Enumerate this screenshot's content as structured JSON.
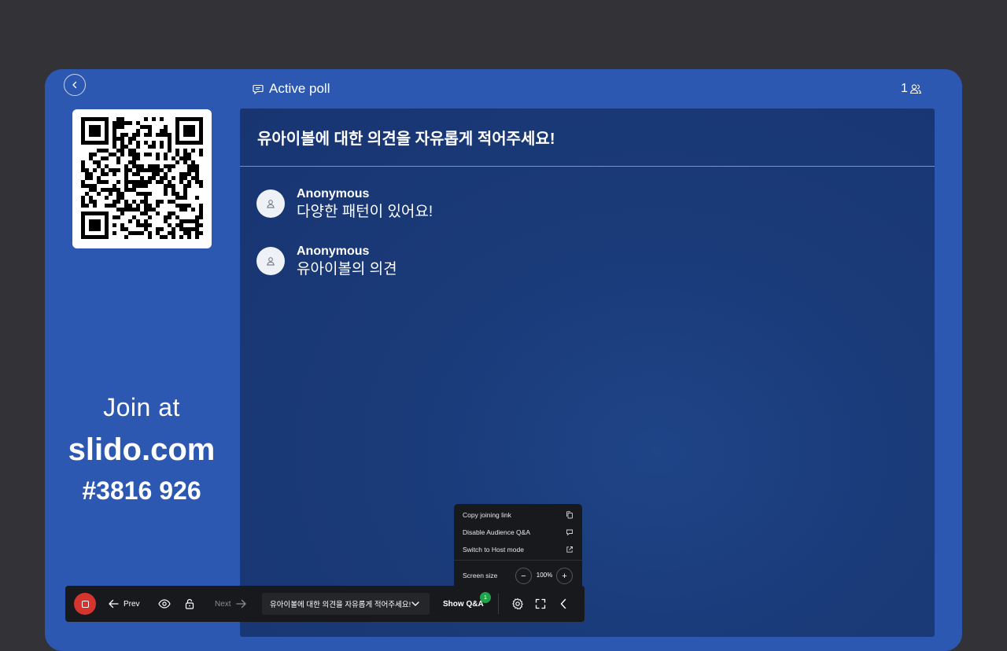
{
  "header": {
    "poll_status": "Active poll",
    "participant_count": "1"
  },
  "join": {
    "line1": "Join at",
    "site": "slido.com",
    "code": "#3816 926"
  },
  "poll": {
    "question": "유아이볼에 대한 의견을 자유롭게 적어주세요!",
    "responses": [
      {
        "author": "Anonymous",
        "text": "다양한 패턴이 있어요!"
      },
      {
        "author": "Anonymous",
        "text": "유아이볼의 의견"
      }
    ]
  },
  "toolbar": {
    "prev_label": "Prev",
    "next_label": "Next",
    "current_poll": "유아이볼에 대한 의견을 자유롭게 적어주세요!",
    "show_qa_label": "Show Q&A",
    "qa_badge": "1"
  },
  "menu": {
    "copy_link": "Copy joining link",
    "disable_qa": "Disable Audience Q&A",
    "host_mode": "Switch to Host mode",
    "screen_size_label": "Screen size",
    "zoom_value": "100%",
    "zoom_minus": "−",
    "zoom_plus": "+"
  },
  "colors": {
    "frame": "#2d58b1",
    "panel": "#1a3a78",
    "toolbar": "#18191c",
    "stop": "#d5352e",
    "badge": "#21a34a"
  }
}
